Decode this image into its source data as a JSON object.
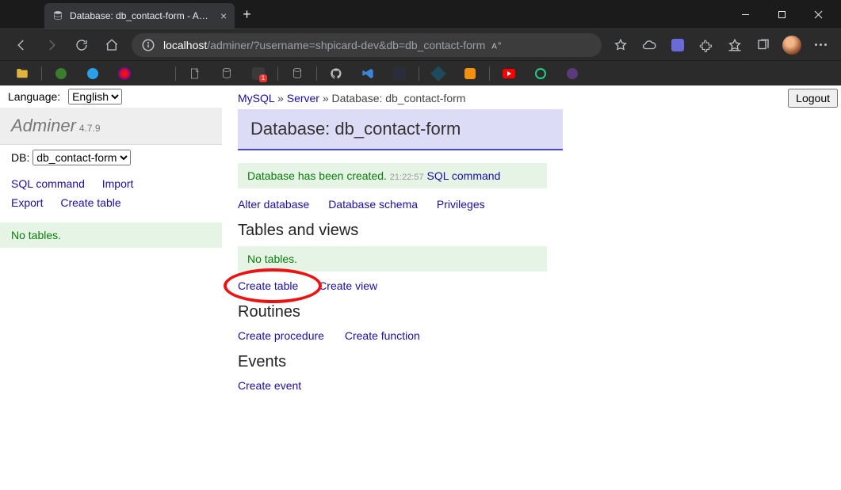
{
  "browser": {
    "tab_title": "Database: db_contact-form - Ad…",
    "url_host": "localhost",
    "url_path": "/adminer/?username=shpicard-dev&db=db_contact-form",
    "url_badge": "A"
  },
  "sidebar": {
    "language_label": "Language:",
    "language_value": "English",
    "brand": "Adminer",
    "version": "4.7.9",
    "db_label": "DB:",
    "db_value": "db_contact-form",
    "links": {
      "sql_command": "SQL command",
      "import": "Import",
      "export": "Export",
      "create_table": "Create table"
    },
    "no_tables": "No tables."
  },
  "main": {
    "crumbs": {
      "engine": "MySQL",
      "server": "Server",
      "db_prefix": "Database: ",
      "db_name": "db_contact-form"
    },
    "title": "Database: db_contact-form",
    "logout_label": "Logout",
    "msg": {
      "text": "Database has been created.",
      "time": "21:22:57",
      "sql": "SQL command"
    },
    "db_links": {
      "alter": "Alter database",
      "schema": "Database schema",
      "privileges": "Privileges"
    },
    "tables_heading": "Tables and views",
    "no_tables": "No tables.",
    "tv_links": {
      "create_table": "Create table",
      "create_view": "Create view"
    },
    "routines_heading": "Routines",
    "rt_links": {
      "create_procedure": "Create procedure",
      "create_function": "Create function"
    },
    "events_heading": "Events",
    "ev_links": {
      "create_event": "Create event"
    }
  }
}
